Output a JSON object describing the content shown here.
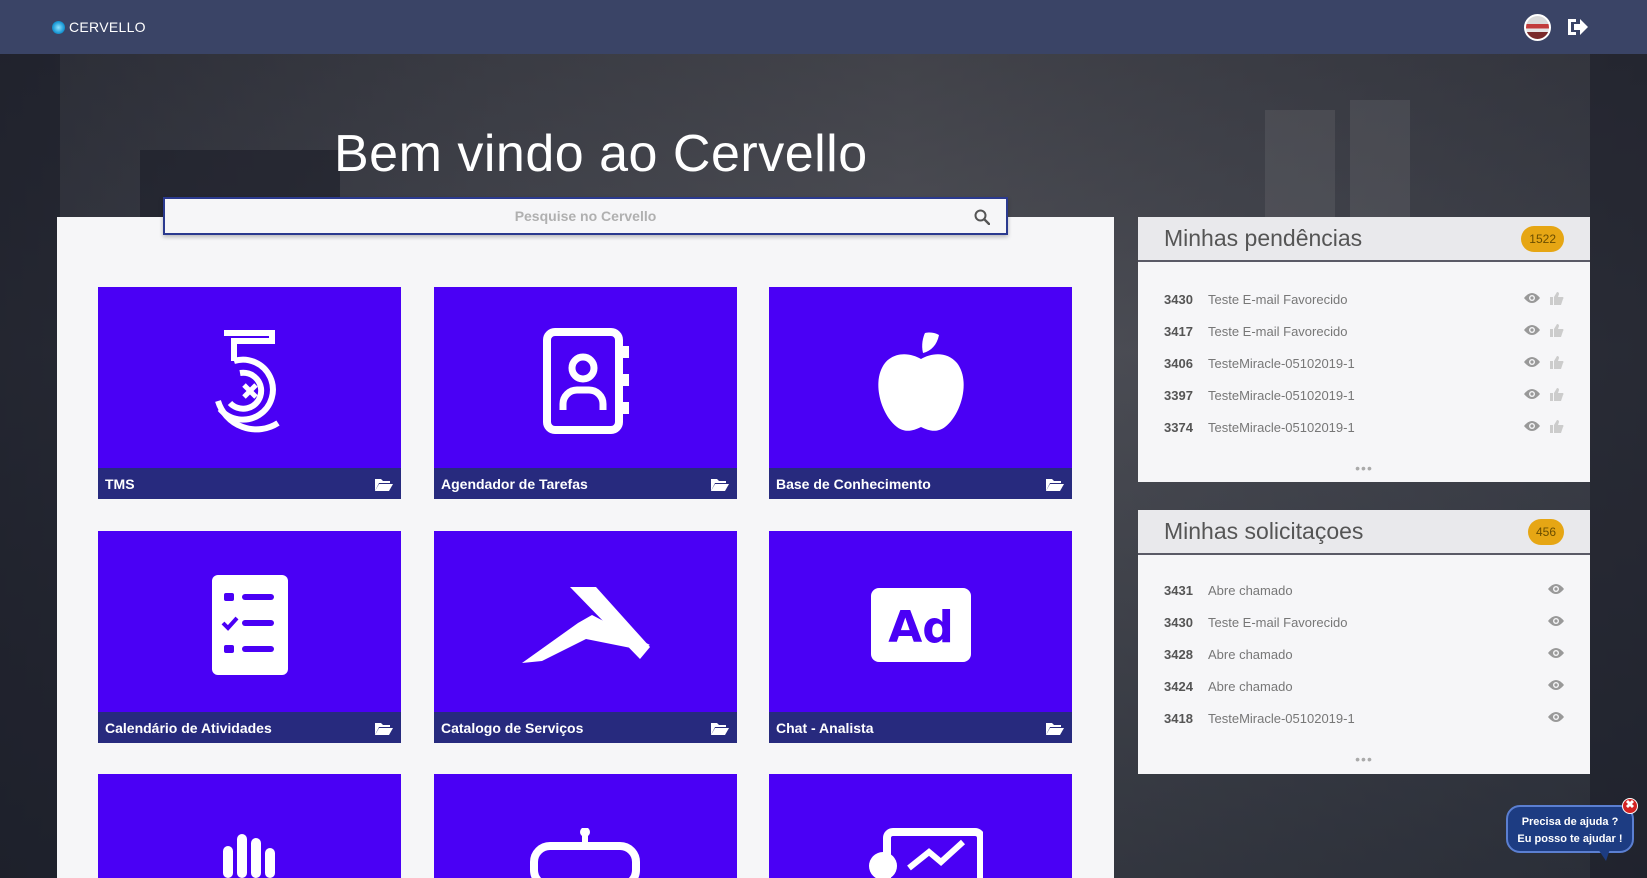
{
  "app": {
    "logo_text": "CERVELLO"
  },
  "welcome_title": "Bem vindo ao Cervello",
  "search": {
    "placeholder": "Pesquise no Cervello"
  },
  "tiles": [
    {
      "label": "TMS",
      "icon": "tms-five-icon"
    },
    {
      "label": "Agendador de Tarefas",
      "icon": "contact-book-icon"
    },
    {
      "label": "Base de Conhecimento",
      "icon": "apple-icon"
    },
    {
      "label": "Calendário de Atividades",
      "icon": "checklist-icon"
    },
    {
      "label": "Catalogo de Serviços",
      "icon": "catalog-arrow-icon"
    },
    {
      "label": "Chat - Analista",
      "icon": "ad-icon"
    },
    {
      "label": "",
      "icon": "hand-icon"
    },
    {
      "label": "",
      "icon": "robot-icon"
    },
    {
      "label": "",
      "icon": "presentation-icon"
    }
  ],
  "pendencias": {
    "title": "Minhas pendências",
    "count": "1522",
    "items": [
      {
        "id": "3430",
        "text": "Teste E-mail Favorecido"
      },
      {
        "id": "3417",
        "text": "Teste E-mail Favorecido"
      },
      {
        "id": "3406",
        "text": "TesteMiracle-05102019-1"
      },
      {
        "id": "3397",
        "text": "TesteMiracle-05102019-1"
      },
      {
        "id": "3374",
        "text": "TesteMiracle-05102019-1"
      }
    ],
    "more": "•••"
  },
  "solicitacoes": {
    "title": "Minhas solicitaçoes",
    "count": "456",
    "items": [
      {
        "id": "3431",
        "text": "Abre chamado"
      },
      {
        "id": "3430",
        "text": "Teste E-mail Favorecido"
      },
      {
        "id": "3428",
        "text": "Abre chamado"
      },
      {
        "id": "3424",
        "text": "Abre chamado"
      },
      {
        "id": "3418",
        "text": "TesteMiracle-05102019-1"
      }
    ],
    "more": "•••"
  },
  "help": {
    "line1": "Precisa de ajuda ?",
    "line2": "Eu posso te ajudar !",
    "close": "✖"
  },
  "colors": {
    "topbar": "#3a4466",
    "tile": "#4a00f5",
    "tile_footer": "#272a7e",
    "badge": "#e6a614"
  }
}
